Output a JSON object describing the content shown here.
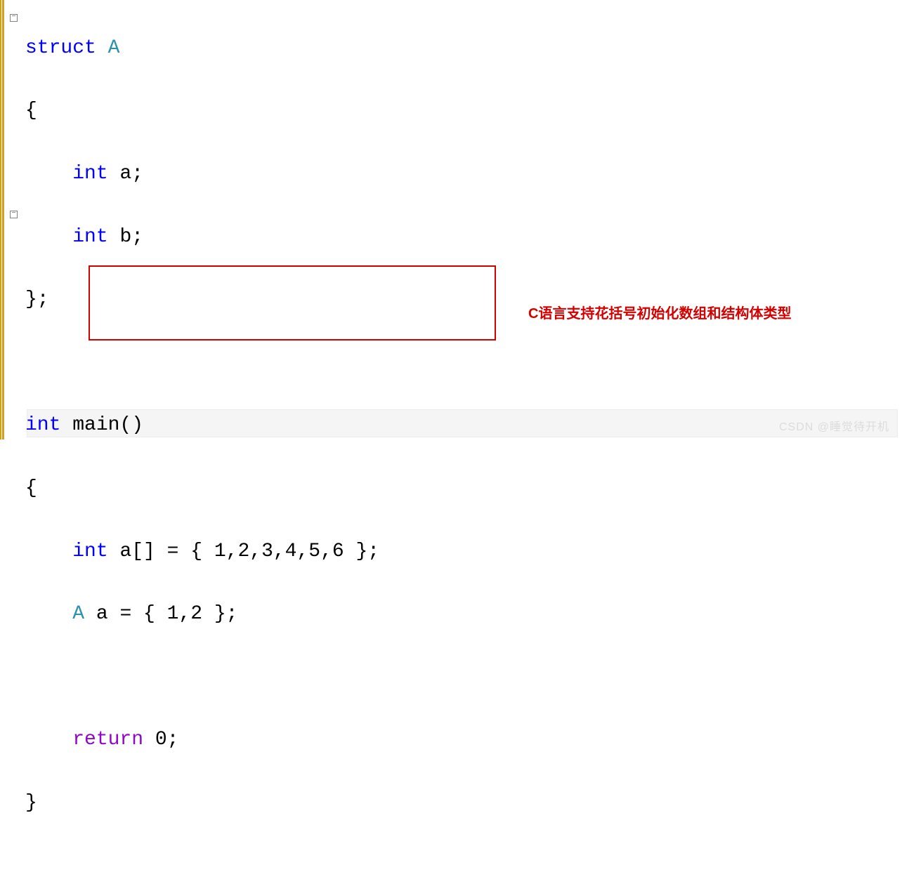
{
  "fold1": "−",
  "fold2": "−",
  "code": {
    "l1_kw": "struct",
    "l1_name": " A",
    "l2": "{",
    "l3_type": "int",
    "l3_rest": " a;",
    "l4_type": "int",
    "l4_rest": " b;",
    "l5": "};",
    "l7_type": "int",
    "l7_rest": " main()",
    "l8": "{",
    "l9_type": "int",
    "l9_rest": " a[] = { 1,2,3,4,5,6 };",
    "l10_type": "A",
    "l10_rest": " a = { 1,2 };",
    "l12_kw": "return",
    "l12_rest": " 0;",
    "l13": "}"
  },
  "annotation": "C语言支持花括号初始化数组和结构体类型",
  "watermark": "CSDN @睡觉待开机",
  "indent": "    "
}
